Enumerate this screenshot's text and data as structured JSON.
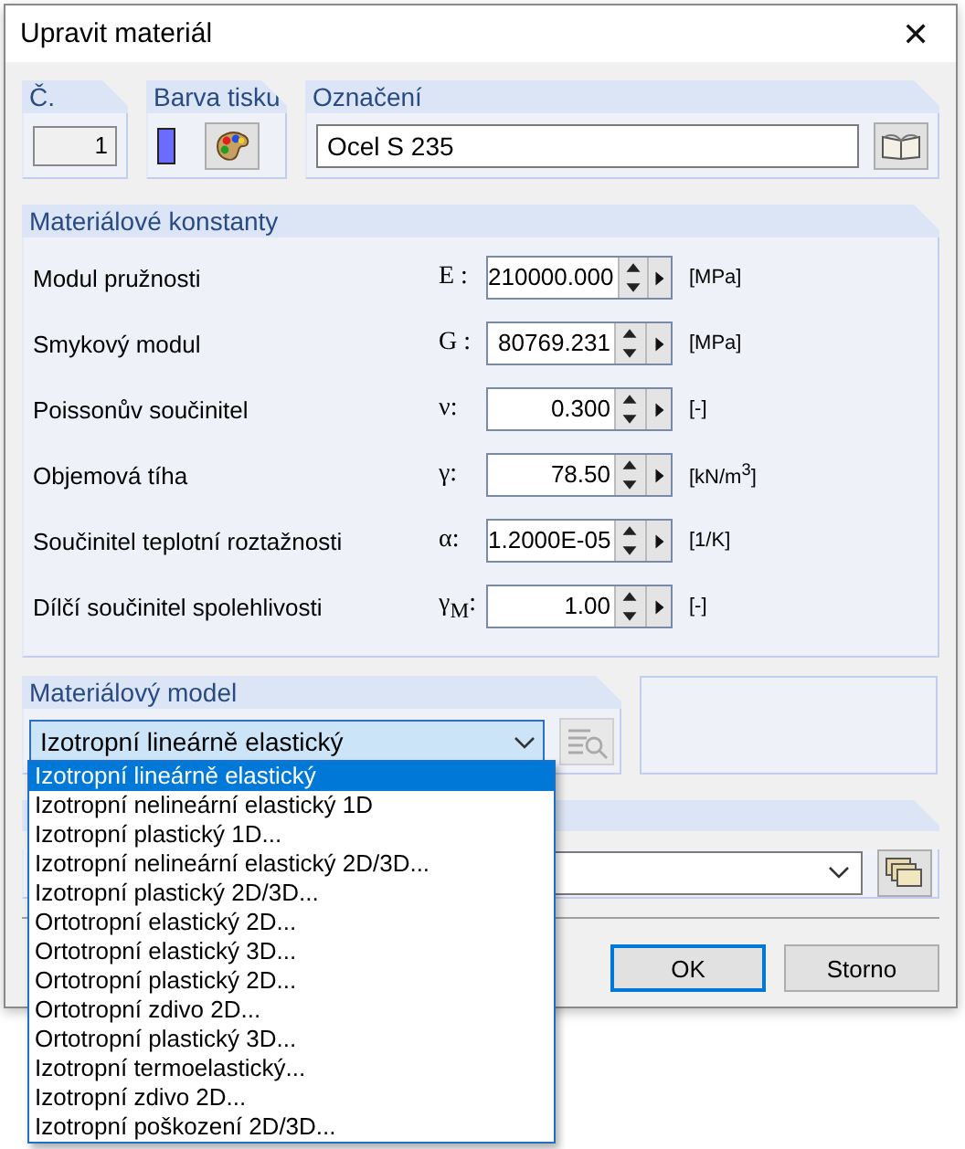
{
  "window": {
    "title": "Upravit materiál",
    "close": "✕"
  },
  "number": {
    "label": "Č.",
    "value": "1"
  },
  "print_color": {
    "label": "Barva tisku",
    "color": "#6b6bff"
  },
  "designation": {
    "label": "Označení",
    "value": "Ocel S 235"
  },
  "constants": {
    "title": "Materiálové konstanty",
    "rows": [
      {
        "label": "Modul pružnosti",
        "symbol": "E :",
        "value": "210000.000",
        "unit": "[MPa]"
      },
      {
        "label": "Smykový modul",
        "symbol": "G :",
        "value": "80769.231",
        "unit": "[MPa]"
      },
      {
        "label": "Poissonův součinitel",
        "symbol": "ν:",
        "value": "0.300",
        "unit": "[-]"
      },
      {
        "label": "Objemová tíha",
        "symbol": "γ:",
        "value": "78.50",
        "unit": "[kN/m$^{3}$]"
      },
      {
        "label": "Součinitel teplotní roztažnosti",
        "symbol": "α:",
        "value": "1.2000E-05",
        "unit": "[1/K]"
      },
      {
        "label": "Dílčí součinitel spolehlivosti",
        "symbol": "γ$_{M}$:",
        "value": "1.00",
        "unit": "[-]"
      }
    ]
  },
  "material_model": {
    "title": "Materiálový model",
    "value": "Izotropní lineárně elastický",
    "expanded": true,
    "details_disabled": true,
    "options": [
      {
        "label": "Izotropní lineárně elastický",
        "selected": true
      },
      {
        "label": "Izotropní nelineární elastický 1D",
        "selected": false
      },
      {
        "label": "Izotropní plastický 1D...",
        "selected": false
      },
      {
        "label": "Izotropní nelineární elastický 2D/3D...",
        "selected": false
      },
      {
        "label": "Izotropní plastický 2D/3D...",
        "selected": false
      },
      {
        "label": "Ortotropní elastický 2D...",
        "selected": false
      },
      {
        "label": "Ortotropní elastický 3D...",
        "selected": false
      },
      {
        "label": "Ortotropní plastický 2D...",
        "selected": false
      },
      {
        "label": "Ortotropní zdivo 2D...",
        "selected": false
      },
      {
        "label": "Ortotropní plastický 3D...",
        "selected": false
      },
      {
        "label": "Izotropní termoelastický...",
        "selected": false
      },
      {
        "label": "Izotropní zdivo 2D...",
        "selected": false
      },
      {
        "label": "Izotropní poškození 2D/3D...",
        "selected": false
      }
    ]
  },
  "buttons": [
    {
      "label": "OK",
      "default": true
    },
    {
      "label": "Storno",
      "default": false
    }
  ]
}
